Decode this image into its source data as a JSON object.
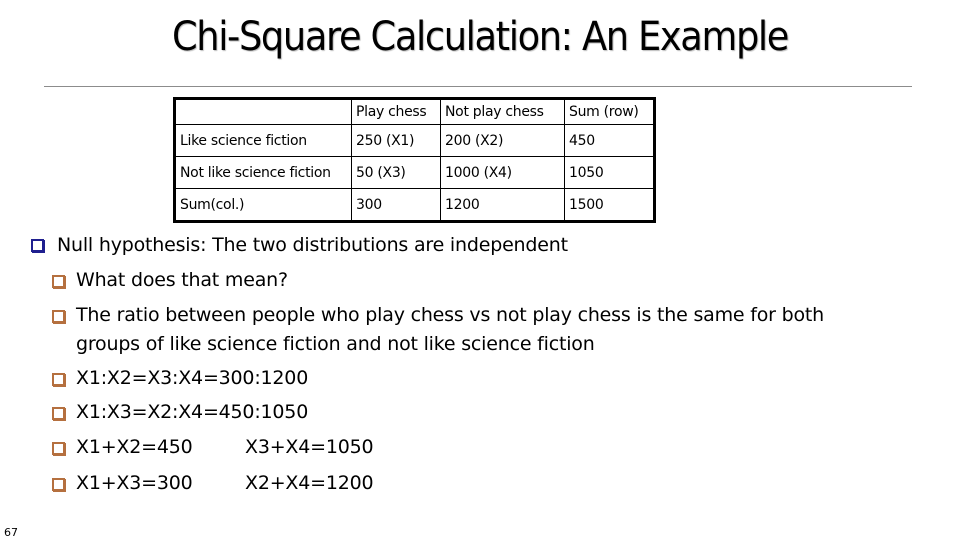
{
  "slide": {
    "title": "Chi-Square Calculation: An Example",
    "page_number": "67"
  },
  "table": {
    "headers": [
      "",
      "Play chess",
      "Not play chess",
      "Sum (row)"
    ],
    "rows": [
      [
        "Like science fiction",
        "250 (X1)",
        "200 (X2)",
        "450"
      ],
      [
        "Not like science fiction",
        "50 (X3)",
        "1000 (X4)",
        "1050"
      ],
      [
        "Sum(col.)",
        "300",
        "1200",
        "1500"
      ]
    ]
  },
  "bullets": {
    "main": "Null hypothesis: The two distributions are independent",
    "sub": [
      {
        "text": "What does that mean?"
      },
      {
        "text": "The ratio between people who play chess vs not play chess is the same for both",
        "continuation": "groups of like science fiction and not like science fiction"
      },
      {
        "text": "X1:X2=X3:X4=300:1200"
      },
      {
        "text": "X1:X3=X2:X4=450:1050"
      },
      {
        "text": "X1+X2=450",
        "second": "X3+X4=1050"
      },
      {
        "text": "X1+X3=300",
        "second": "X2+X4=1200"
      }
    ]
  },
  "colors": {
    "bullet_level1": "#1f1f8f",
    "bullet_level2": "#b5703f",
    "rule": "#8c8c8c"
  }
}
